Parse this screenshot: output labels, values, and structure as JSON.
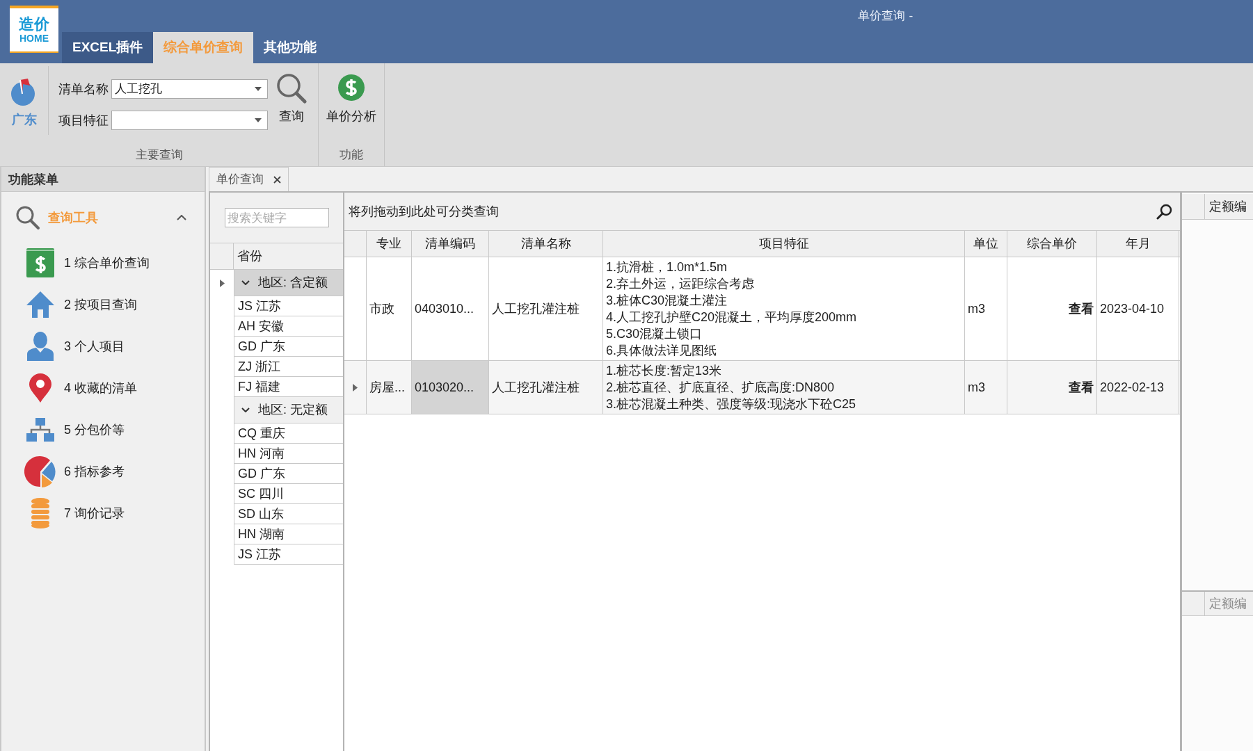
{
  "window": {
    "title": "单价查询 -"
  },
  "logo": {
    "line1": "造价",
    "line2": "HOME"
  },
  "ribbon_tabs": [
    {
      "label": "EXCEL插件",
      "selected": false
    },
    {
      "label": "综合单价查询",
      "selected": true
    },
    {
      "label": "其他功能",
      "selected": false
    }
  ],
  "ribbon": {
    "location_button": "广东",
    "fields": [
      {
        "label": "清单名称",
        "value": "人工挖孔"
      },
      {
        "label": "项目特征"
      }
    ],
    "query_button": "查询",
    "main_group_label": "主要查询",
    "analysis_button": "单价分析",
    "function_group_label": "功能"
  },
  "sidebar": {
    "title": "功能菜单",
    "section": {
      "label": "查询工具",
      "expanded": true
    },
    "items": [
      {
        "label": "1 综合单价查询"
      },
      {
        "label": "2 按项目查询"
      },
      {
        "label": "3 个人项目"
      },
      {
        "label": "4 收藏的清单"
      },
      {
        "label": "5 分包价等"
      },
      {
        "label": "6 指标参考"
      },
      {
        "label": "7 询价记录"
      }
    ]
  },
  "doc_tabs": [
    {
      "label": "单价查询",
      "selected": true
    }
  ],
  "province_panel": {
    "search": {
      "placeholder": "搜索关键字"
    },
    "column": "省份",
    "groups": [
      {
        "label": "地区: 含定额",
        "expanded": true,
        "current": true,
        "rows": [
          "JS 江苏",
          "AH 安徽",
          "GD 广东",
          "ZJ 浙江",
          "FJ 福建"
        ]
      },
      {
        "label": "地区: 无定额",
        "expanded": true,
        "current": false,
        "rows": [
          "CQ 重庆",
          "HN 河南",
          "GD 广东",
          "SC 四川",
          "SD 山东",
          "HN 湖南",
          "JS 江苏"
        ]
      }
    ]
  },
  "grid": {
    "group_hint": "将列拖动到此处可分类查询",
    "columns": [
      "专业",
      "清单编码",
      "清单名称",
      "项目特征",
      "单位",
      "综合单价",
      "年月"
    ],
    "rows": [
      {
        "current": false,
        "cells": [
          {
            "text": "市政",
            "focused": false
          },
          {
            "text": "0403010...",
            "focused": false
          },
          {
            "text": "人工挖孔灌注桩",
            "focused": false
          },
          {
            "lines": [
              "1.抗滑桩，1.0m*1.5m",
              "2.弃土外运，运距综合考虑",
              "3.桩体C30混凝土灌注",
              "4.人工挖孔护壁C20混凝土，平均厚度200mm",
              "5.C30混凝土锁口",
              "6.具体做法详见图纸"
            ],
            "focused": false
          },
          {
            "text": "m3",
            "focused": false
          },
          {
            "text": "查看",
            "focused": false
          },
          {
            "text": "2023-04-10",
            "focused": false
          }
        ]
      },
      {
        "current": true,
        "cells": [
          {
            "text": "房屋...",
            "focused": false
          },
          {
            "text": "0103020...",
            "focused": true
          },
          {
            "text": "人工挖孔灌注桩",
            "focused": false
          },
          {
            "lines": [
              "1.桩芯长度:暂定13米",
              "2.桩芯直径、扩底直径、扩底高度:DN800",
              "3.桩芯混凝土种类、强度等级:现浇水下砼C25"
            ],
            "focused": false
          },
          {
            "text": "m3",
            "focused": false
          },
          {
            "text": "查看",
            "focused": false
          },
          {
            "text": "2022-02-13",
            "focused": false
          }
        ]
      }
    ]
  },
  "right_panel": {
    "headers": [
      "定额编",
      "定额编"
    ]
  }
}
